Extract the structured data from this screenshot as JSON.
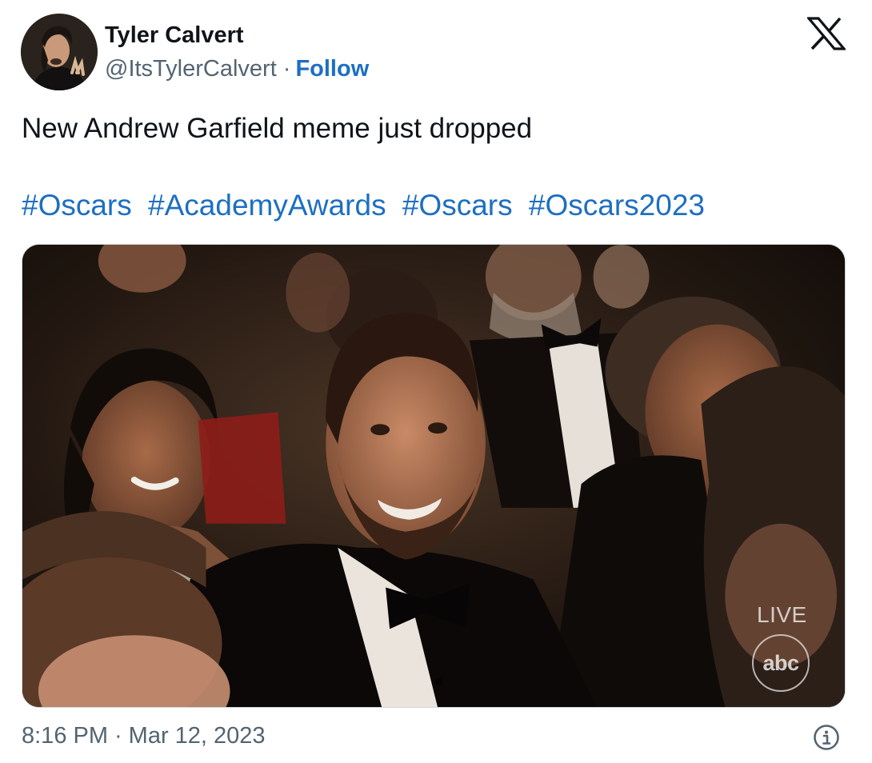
{
  "author": {
    "display_name": "Tyler Calvert",
    "handle": "@ItsTylerCalvert",
    "separator": "·",
    "follow_label": "Follow"
  },
  "platform_icon": "x-logo-icon",
  "tweet": {
    "text": "New Andrew Garfield meme just dropped",
    "hashtags": [
      "#Oscars",
      "#AcademyAwards",
      "#Oscars",
      "#Oscars2023"
    ]
  },
  "media": {
    "overlay_live": "LIVE",
    "overlay_network": "abc"
  },
  "footer": {
    "time": "8:16 PM",
    "separator": "·",
    "date": "Mar 12, 2023",
    "info_icon": "info-icon"
  },
  "colors": {
    "link": "#1d6fc2",
    "text": "#0f1419",
    "muted": "#536471",
    "border": "#cfd9de"
  }
}
